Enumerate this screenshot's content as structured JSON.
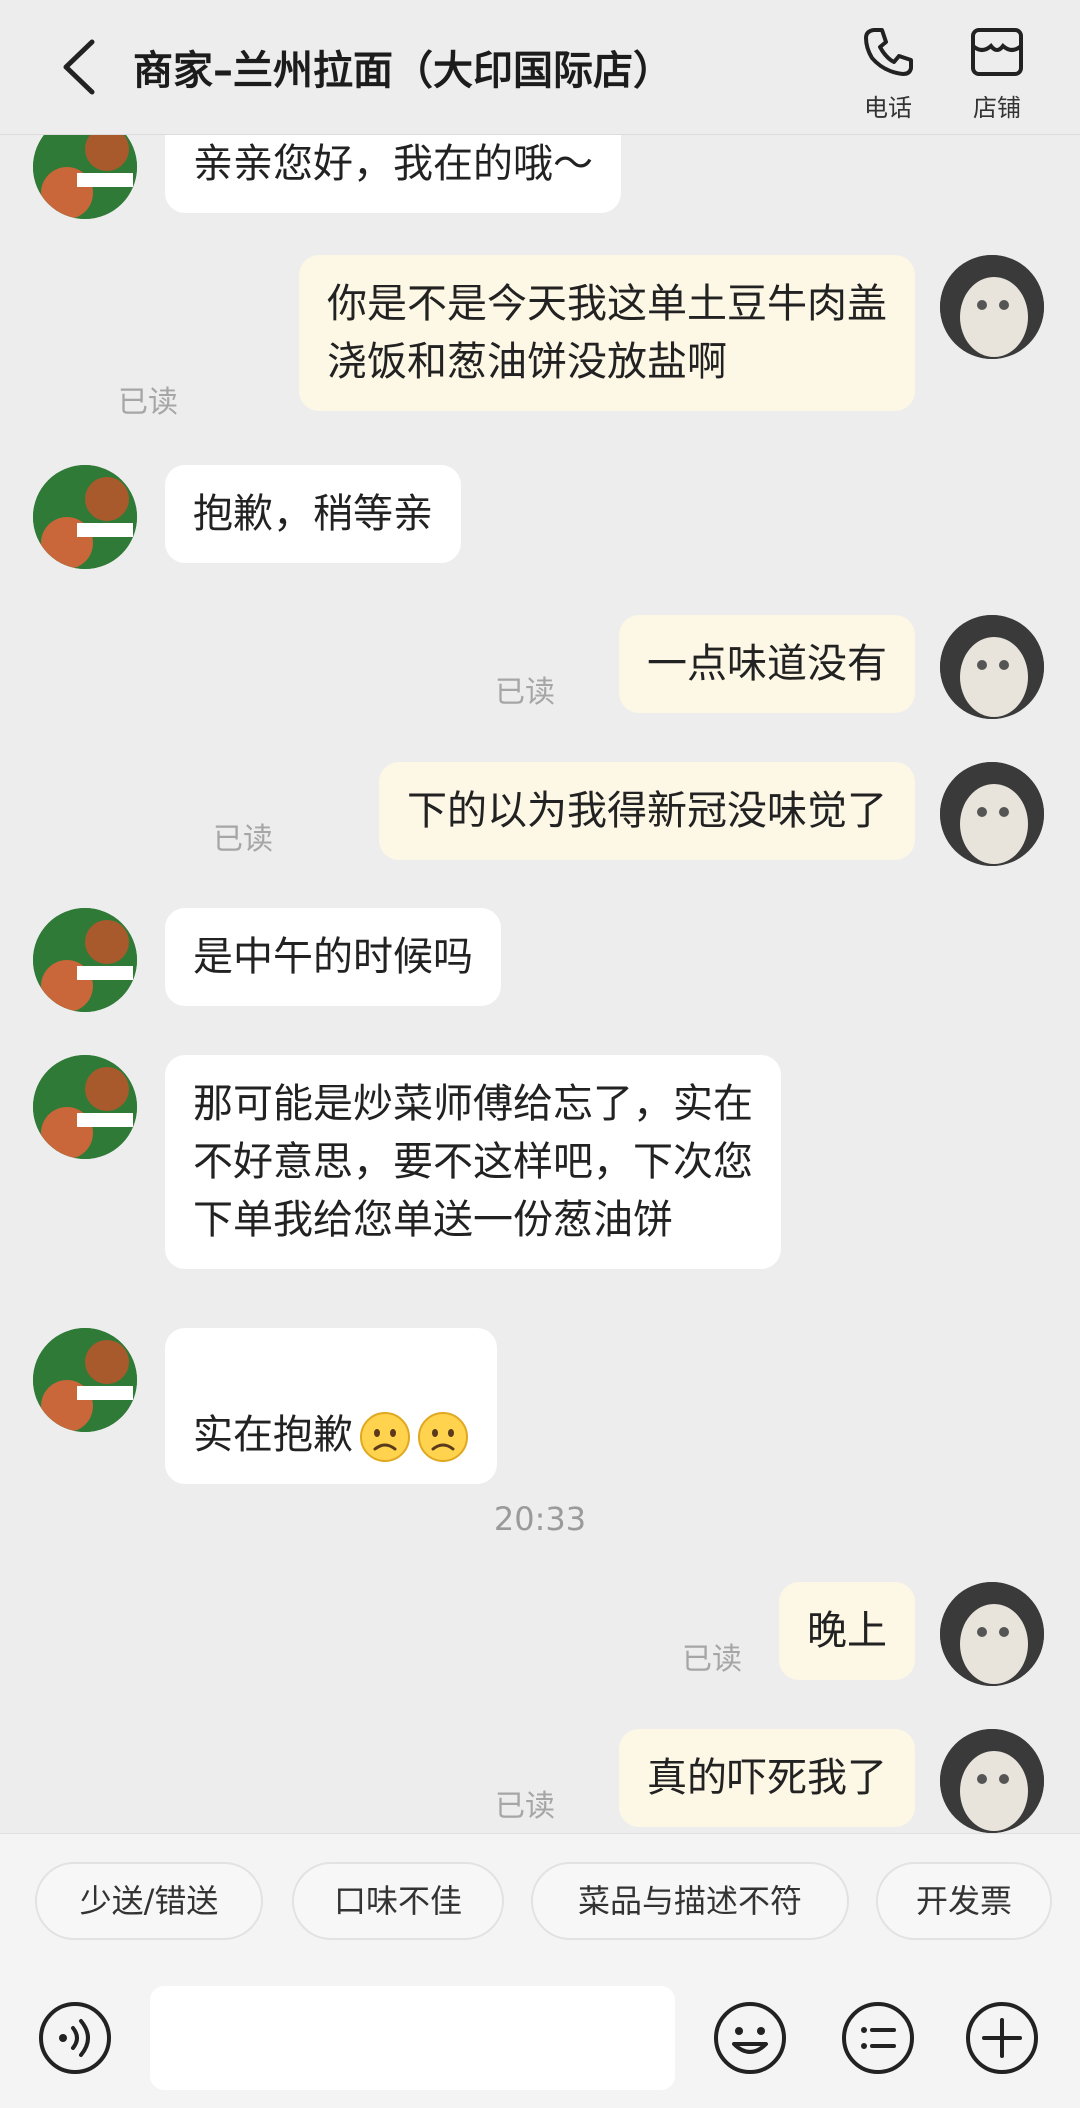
{
  "header": {
    "title": "商家–兰州拉面（大印国际店）",
    "phone_label": "电话",
    "store_label": "店铺"
  },
  "messages": [
    {
      "from": "shop",
      "text": "亲亲您好，我在的哦～"
    },
    {
      "from": "user",
      "text": "你是不是今天我这单土豆牛肉盖\n浇饭和葱油饼没放盐啊",
      "status": "已读"
    },
    {
      "from": "shop",
      "text": "抱歉，稍等亲"
    },
    {
      "from": "user",
      "text": "一点味道没有",
      "status": "已读"
    },
    {
      "from": "user",
      "text": "下的以为我得新冠没味觉了",
      "status": "已读"
    },
    {
      "from": "shop",
      "text": "是中午的时候吗"
    },
    {
      "from": "shop",
      "text": "那可能是炒菜师傅给忘了，实在\n不好意思，要不这样吧，下次您\n下单我给您单送一份葱油饼"
    },
    {
      "from": "shop",
      "text": "实在抱歉",
      "emojis": [
        "worried-face-emoji",
        "worried-face-emoji"
      ]
    },
    {
      "from": "user",
      "text": "晚上",
      "status": "已读"
    },
    {
      "from": "user",
      "text": "真的吓死我了",
      "status": "已读"
    }
  ],
  "timestamp": "20:33",
  "quick_replies": [
    "少送/错送",
    "口味不佳",
    "菜品与描述不符",
    "开发票"
  ],
  "input": {
    "value": "",
    "placeholder": ""
  },
  "colors": {
    "background": "#ededed",
    "incoming_bubble": "#ffffff",
    "outgoing_bubble": "#fdf7e6",
    "read_status": "#a6a6a6"
  },
  "icons": [
    "back-arrow-icon",
    "phone-icon",
    "store-icon",
    "voice-icon",
    "emoji-icon",
    "quick-phrase-icon",
    "plus-icon"
  ]
}
